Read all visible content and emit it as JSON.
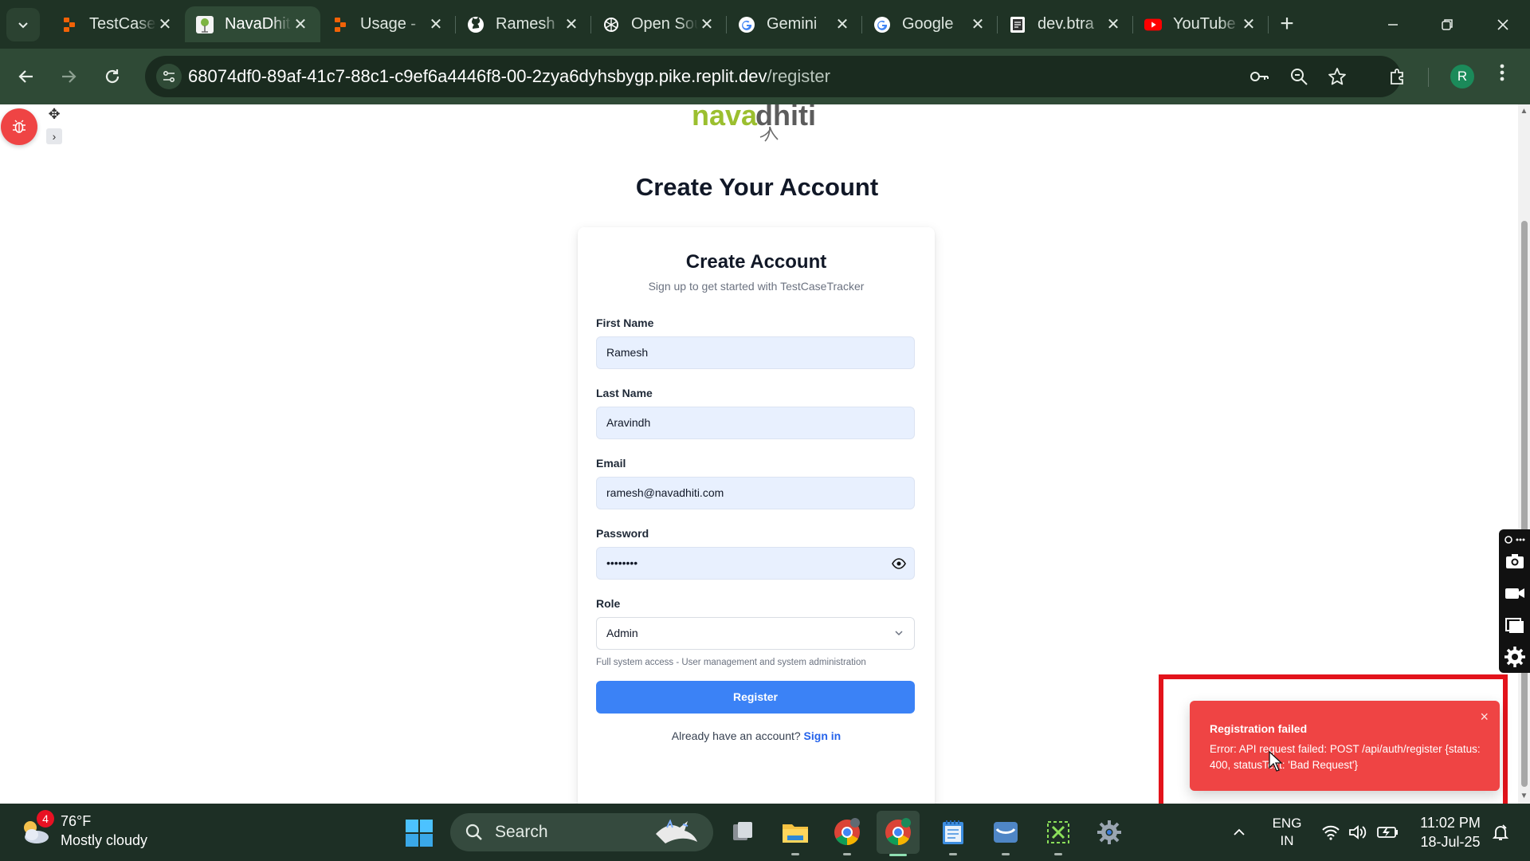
{
  "browser": {
    "tabs": [
      {
        "title": "TestCase",
        "favicon": "replit-icon",
        "color": "#f26207"
      },
      {
        "title": "NavaDhiti",
        "favicon": "navadhiti-icon",
        "color": "#7db443"
      },
      {
        "title": "Usage - ",
        "favicon": "replit-icon",
        "color": "#f26207"
      },
      {
        "title": "Ramesh",
        "favicon": "github-icon",
        "color": "#ffffff"
      },
      {
        "title": "Open Sou",
        "favicon": "openai-icon",
        "color": "#ffffff"
      },
      {
        "title": "Gemini",
        "favicon": "google-icon",
        "color": "#ffffff"
      },
      {
        "title": "Google",
        "favicon": "google-icon",
        "color": "#ffffff"
      },
      {
        "title": "dev.btra",
        "favicon": "doc-icon",
        "color": "#ffffff"
      },
      {
        "title": "YouTube",
        "favicon": "youtube-icon",
        "color": "#ff0000"
      }
    ],
    "active_tab_index": 1,
    "url_host": "68074df0-89af-41c7-88c1-c9ef6a4446f8-00-2zya6dyhsbygp.pike.replit.dev",
    "url_path": "/register",
    "profile_initial": "R"
  },
  "page": {
    "brand_left": "nava",
    "brand_right": "dhiti",
    "title": "Create Your Account",
    "card": {
      "title": "Create Account",
      "subtitle": "Sign up to get started with TestCaseTracker",
      "first_name_label": "First Name",
      "first_name_value": "Ramesh",
      "last_name_label": "Last Name",
      "last_name_value": "Aravindh",
      "email_label": "Email",
      "email_value": "ramesh@navadhiti.com",
      "password_label": "Password",
      "password_value": "••••••••",
      "role_label": "Role",
      "role_value": "Admin",
      "role_hint": "Full system access - User management and system administration",
      "register_label": "Register",
      "signin_prompt": "Already have an account?",
      "signin_link": "Sign in"
    }
  },
  "toast": {
    "title": "Registration failed",
    "body": "Error: API request failed: POST /api/auth/register {status: 400, statusText: 'Bad Request'}",
    "close": "×"
  },
  "taskbar": {
    "weather_badge": "4",
    "temperature": "76°F",
    "condition": "Mostly cloudy",
    "search_label": "Search",
    "lang_top": "ENG",
    "lang_bottom": "IN",
    "time": "11:02 PM",
    "date": "18-Jul-25"
  },
  "colors": {
    "accent_blue": "#3b82f6",
    "error_red": "#ef4444",
    "highlight_outline": "#e3131b",
    "browser_frame": "#1f3325"
  }
}
